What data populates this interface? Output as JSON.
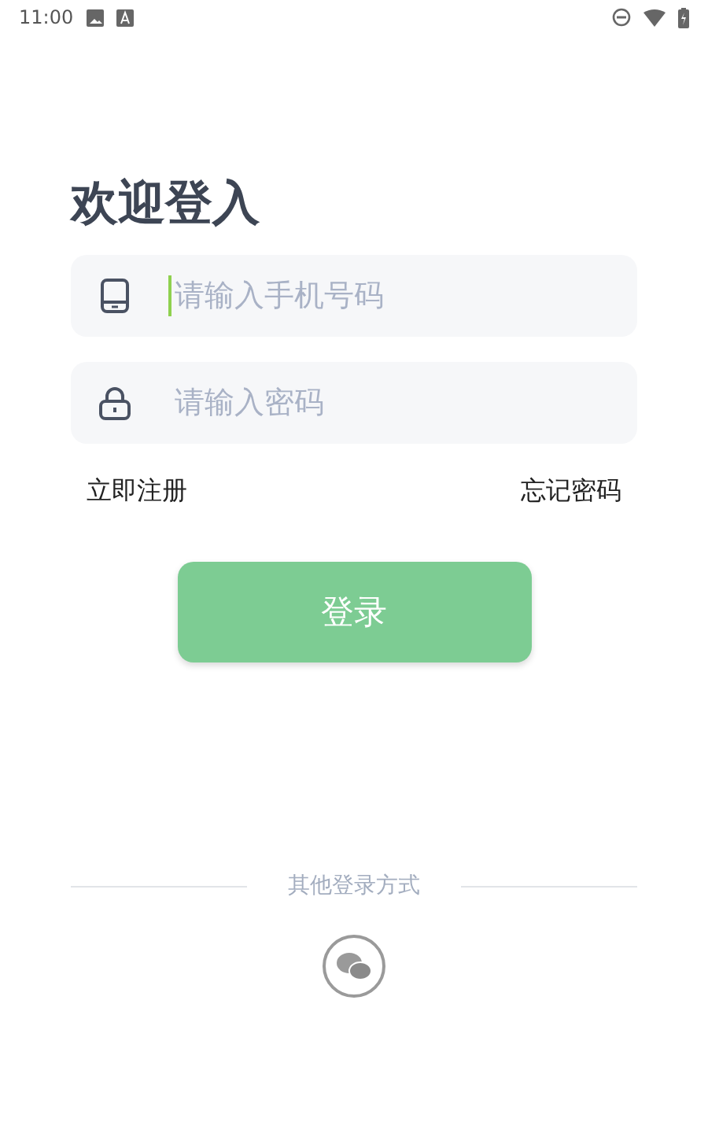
{
  "status_bar": {
    "time": "11:00"
  },
  "title": "欢迎登入",
  "fields": [
    {
      "kind": "phone",
      "placeholder": "请输入手机号码",
      "focused": true
    },
    {
      "kind": "password",
      "placeholder": "请输入密码",
      "focused": false
    }
  ],
  "links": [
    "立即注册",
    "忘记密码"
  ],
  "login_button": "登录",
  "other_login": {
    "label": "其他登录方式"
  }
}
